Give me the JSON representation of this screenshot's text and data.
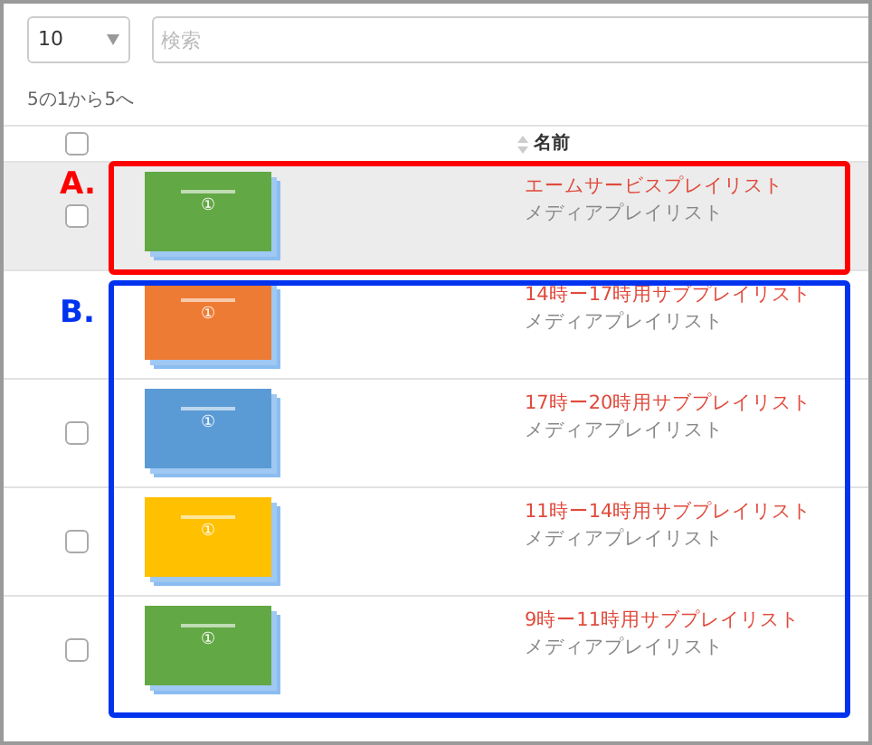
{
  "page_size": {
    "value": "10"
  },
  "search": {
    "placeholder": "検索"
  },
  "summary": "5の1から5へ",
  "table": {
    "select_all": {
      "checked": false
    },
    "columns": [
      {
        "label": "名前"
      }
    ],
    "rows": [
      {
        "checked": false,
        "selected": true,
        "color": "#62a844",
        "thumb_label": "①",
        "title": "エームサービスプレイリスト",
        "subtitle": "メディアプレイリスト"
      },
      {
        "selected": false,
        "color": "#ee7b33",
        "thumb_label": "①",
        "title": "14時ー17時用サブプレイリスト",
        "subtitle": "メディアプレイリスト"
      },
      {
        "checked": false,
        "selected": false,
        "color": "#5b9bd5",
        "thumb_label": "①",
        "title": "17時ー20時用サブプレイリスト",
        "subtitle": "メディアプレイリスト"
      },
      {
        "checked": false,
        "selected": false,
        "color": "#ffc000",
        "thumb_label": "①",
        "title": "11時ー14時用サブプレイリスト",
        "subtitle": "メディアプレイリスト"
      },
      {
        "checked": false,
        "selected": false,
        "color": "#62a844",
        "thumb_label": "①",
        "title": "9時ー11時用サブプレイリスト",
        "subtitle": "メディアプレイリスト"
      }
    ]
  },
  "annotations": [
    {
      "label": "A.",
      "color": "#ff0000"
    },
    {
      "label": "B.",
      "color": "#0033ee"
    }
  ]
}
